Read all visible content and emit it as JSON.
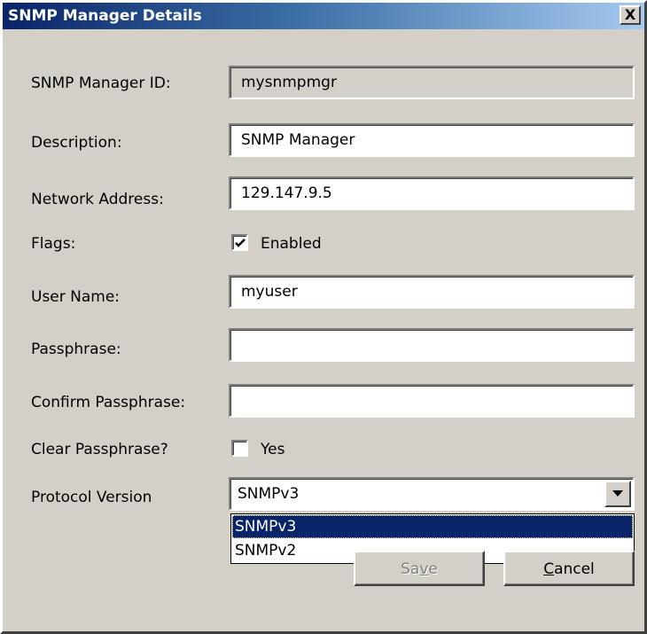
{
  "window": {
    "title": "SNMP Manager Details",
    "close_glyph": "X"
  },
  "form": {
    "manager_id": {
      "label": "SNMP Manager ID:",
      "value": "mysnmpmgr"
    },
    "description": {
      "label": "Description:",
      "value": "SNMP Manager"
    },
    "network_address": {
      "label": "Network Address:",
      "value": "129.147.9.5"
    },
    "flags": {
      "label": "Flags:",
      "option_label": "Enabled",
      "checked": true
    },
    "user_name": {
      "label": "User Name:",
      "value": "myuser"
    },
    "passphrase": {
      "label": "Passphrase:",
      "value": ""
    },
    "confirm_passphrase": {
      "label": "Confirm Passphrase:",
      "value": ""
    },
    "clear_passphrase": {
      "label": "Clear Passphrase?",
      "option_label": "Yes",
      "checked": false
    },
    "protocol_version": {
      "label": "Protocol Version",
      "value": "SNMPv3",
      "options": [
        "SNMPv3",
        "SNMPv2"
      ],
      "highlighted_option": "SNMPv3"
    }
  },
  "buttons": {
    "save": {
      "pre": "Sa",
      "mnemonic": "v",
      "post": "e",
      "enabled": false
    },
    "cancel": {
      "pre": "",
      "mnemonic": "C",
      "post": "ancel",
      "enabled": true
    }
  },
  "colors": {
    "title_start": "#0a246a",
    "title_end": "#a6caf0",
    "dialog_face": "#d4d0c8",
    "highlight": "#0a246a"
  },
  "icons": {
    "close": "close-icon",
    "checkbox_check": "checkmark-icon",
    "dropdown_arrow": "chevron-down-icon"
  }
}
